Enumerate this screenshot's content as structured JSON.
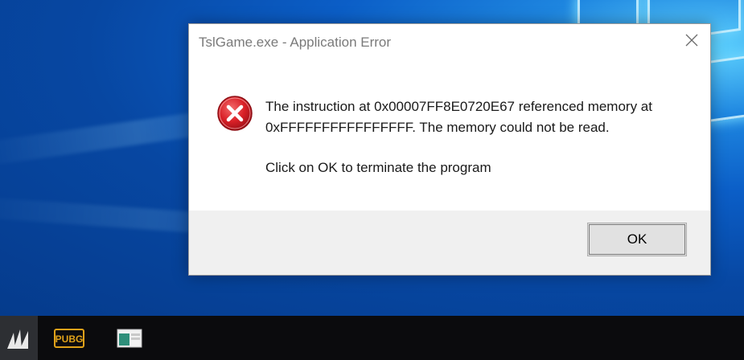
{
  "dialog": {
    "title": "TslGame.exe - Application Error",
    "message_line1": "The instruction at 0x00007FF8E0720E67 referenced memory at",
    "message_line2": "0xFFFFFFFFFFFFFFFF. The memory could not be read.",
    "message_line3": "Click on OK to terminate the program",
    "ok_label": "OK",
    "icons": {
      "error": "error-x-icon",
      "close": "close-icon"
    }
  },
  "taskbar": {
    "items": [
      {
        "name": "corsair-icon",
        "active": true
      },
      {
        "name": "pubg-icon",
        "label": "PUBG"
      },
      {
        "name": "app-window-icon"
      }
    ]
  },
  "colors": {
    "desktop_blue": "#0747a2",
    "taskbar": "#0b0b0d",
    "error_red": "#d92027"
  }
}
